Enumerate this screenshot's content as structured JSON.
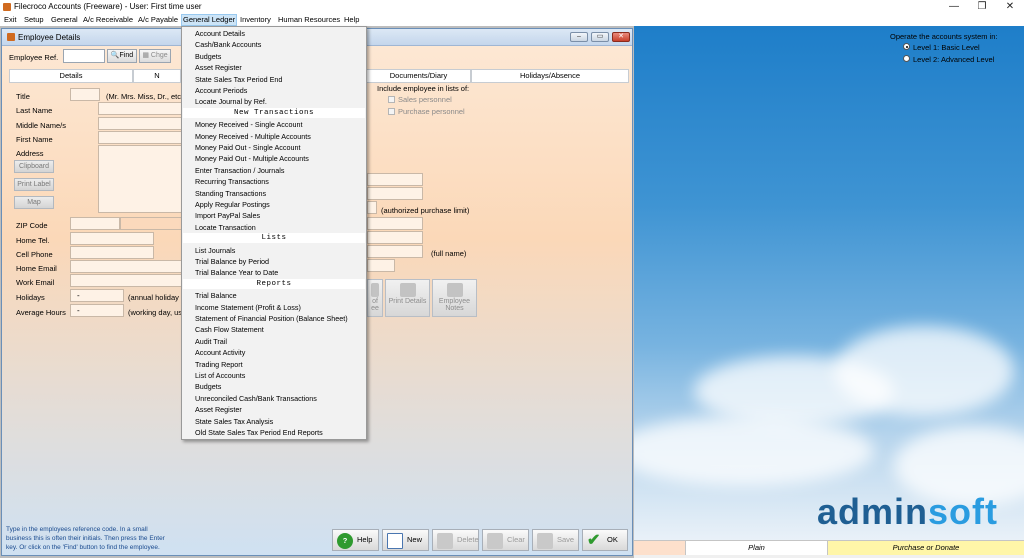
{
  "window": {
    "title": "Filecroco Accounts (Freeware)  -  User: First time user",
    "minimize": "—",
    "maximize": "❐",
    "close": "✕"
  },
  "menubar": [
    {
      "label": "Exit"
    },
    {
      "label": "Setup"
    },
    {
      "label": "General"
    },
    {
      "label": "A/c Receivable"
    },
    {
      "label": "A/c Payable"
    },
    {
      "label": "General Ledger",
      "active": true
    },
    {
      "label": "Inventory"
    },
    {
      "label": "Human Resources"
    },
    {
      "label": "Help"
    }
  ],
  "employee_window": {
    "title": "Employee Details",
    "ref_label": "Employee Ref.",
    "find_label": "Find",
    "chge_label": "Chge",
    "tabs": {
      "details": "Details",
      "second": "N",
      "documents": "Documents/Diary",
      "holidays": "Holidays/Absence"
    },
    "fields": {
      "title": "Title",
      "title_hint": "(Mr. Mrs. Miss, Dr., etc.)",
      "last_name": "Last Name",
      "middle_names": "Middle Name/s",
      "first_name": "First Name",
      "address": "Address",
      "zip": "ZIP Code",
      "home_tel": "Home Tel.",
      "cell_phone": "Cell Phone",
      "home_email": "Home Email",
      "work_email": "Work Email",
      "holidays": "Holidays",
      "holidays_value": "-",
      "holidays_hint": "(annual holiday",
      "average_hours": "Average Hours",
      "average_hours_value": "-",
      "average_hours_hint": "(working day, us"
    },
    "side_buttons": {
      "clipboard": "Clipboard",
      "print_label": "Print Label",
      "map": "Map"
    },
    "include_label": "Include employee in lists of:",
    "sales_personnel": "Sales personnel",
    "purchase_personnel": "Purchase personnel",
    "purchase_limit_hint": "(authorized purchase limit)",
    "full_name_hint": "(full name)",
    "big_buttons": {
      "partial": "of\nee",
      "print_details": "Print Details",
      "employee_notes": "Employee Notes"
    },
    "status_info": "Type in the employees reference code.  In a small business this is often their initials.  Then press the Enter key. Or click on the 'Find' button to find the employee.",
    "bottom_buttons": {
      "help": "Help",
      "new": "New",
      "delete": "Delete",
      "clear": "Clear",
      "save": "Save",
      "ok": "OK"
    }
  },
  "general_ledger_menu": [
    {
      "label": "Account Details"
    },
    {
      "label": "Cash/Bank Accounts"
    },
    {
      "label": "Budgets"
    },
    {
      "label": "Asset Register"
    },
    {
      "label": "State Sales Tax Period End"
    },
    {
      "label": "Account Periods"
    },
    {
      "label": "Locate Journal by Ref."
    },
    {
      "label": "New Transactions",
      "header": true
    },
    {
      "label": "Money Received - Single Account"
    },
    {
      "label": "Money Received - Multiple Accounts"
    },
    {
      "label": "Money Paid Out - Single Account"
    },
    {
      "label": "Money Paid Out - Multiple Accounts"
    },
    {
      "label": "Enter Transaction / Journals"
    },
    {
      "label": "Recurring Transactions"
    },
    {
      "label": "Standing Transactions"
    },
    {
      "label": "Apply Regular Postings"
    },
    {
      "label": "Import PayPal Sales"
    },
    {
      "label": "Locate Transaction"
    },
    {
      "label": "Lists",
      "header": true
    },
    {
      "label": "List Journals"
    },
    {
      "label": "Trial Balance by Period"
    },
    {
      "label": "Trial Balance Year to Date"
    },
    {
      "label": "Reports",
      "header": true
    },
    {
      "label": "Trial Balance"
    },
    {
      "label": "Income Statement (Profit & Loss)"
    },
    {
      "label": "Statement of Financial Position (Balance Sheet)"
    },
    {
      "label": "Cash Flow Statement"
    },
    {
      "label": "Audit Trail"
    },
    {
      "label": "Account Activity"
    },
    {
      "label": "Trading Report"
    },
    {
      "label": "List of Accounts"
    },
    {
      "label": "Budgets"
    },
    {
      "label": "Unreconciled Cash/Bank Transactions"
    },
    {
      "label": "Asset Register"
    },
    {
      "label": "State Sales Tax Analysis"
    },
    {
      "label": "Old State Sales Tax Period End Reports"
    }
  ],
  "right_panel": {
    "operate_label": "Operate the accounts system in:",
    "level1": "Level 1: Basic Level",
    "level2": "Level 2: Advanced Level",
    "logo_a": "admin",
    "logo_b": "soft",
    "bar_plain": "Plain",
    "bar_purchase": "Purchase or Donate"
  }
}
